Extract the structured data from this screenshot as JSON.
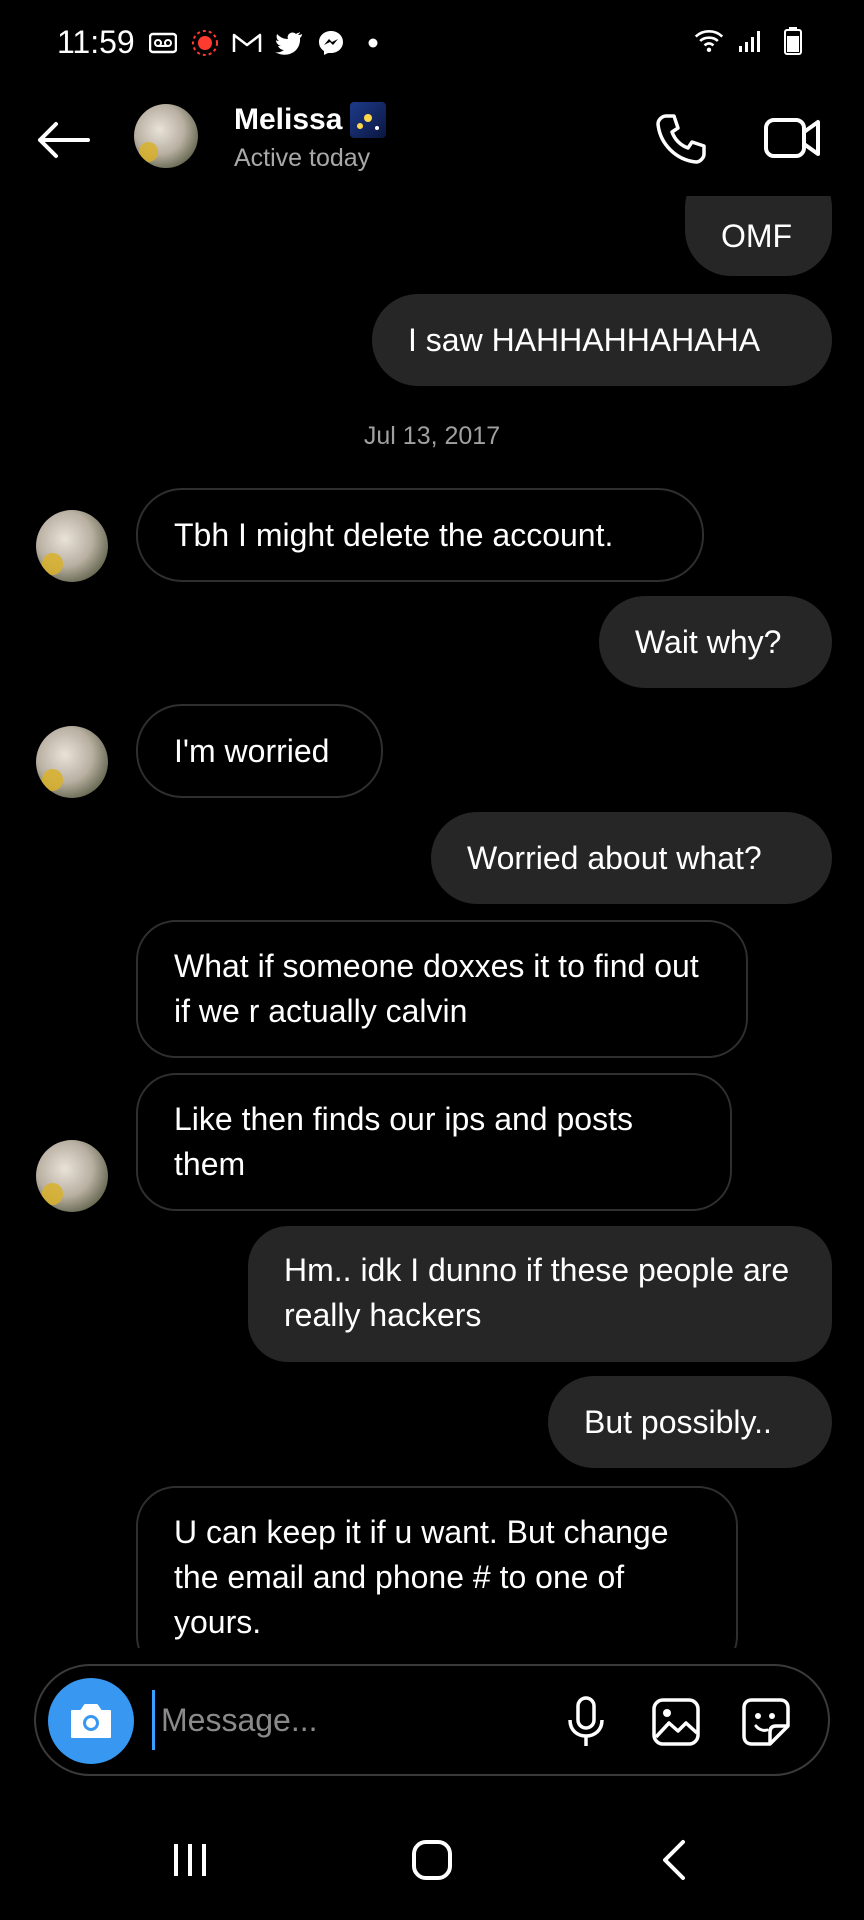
{
  "status_bar": {
    "time": "11:59",
    "left_icons": [
      "voicemail-icon",
      "recording-icon",
      "gmail-icon",
      "twitter-icon",
      "messenger-icon",
      "dot-icon"
    ],
    "right_icons": [
      "wifi-icon",
      "signal-icon",
      "battery-icon"
    ]
  },
  "header": {
    "contact_name": "Melissa",
    "name_emoji": "night-sky-emoji",
    "status": "Active today"
  },
  "thread": {
    "messages": [
      {
        "type": "sent",
        "text": "OMF"
      },
      {
        "type": "sent",
        "text": "I saw HAHHAHHAHAHA"
      },
      {
        "type": "date",
        "text": "Jul 13, 2017"
      },
      {
        "type": "received",
        "text": "Tbh I might delete the account."
      },
      {
        "type": "sent",
        "text": "Wait why?"
      },
      {
        "type": "received",
        "text": "I'm worried"
      },
      {
        "type": "sent",
        "text": "Worried about what?"
      },
      {
        "type": "received",
        "text": "What if someone doxxes it to find out if we r actually calvin"
      },
      {
        "type": "received",
        "text": "Like then finds our ips and posts them"
      },
      {
        "type": "sent",
        "text": "Hm.. idk I dunno if these people are really hackers"
      },
      {
        "type": "sent",
        "text": "But possibly.."
      },
      {
        "type": "received",
        "text": "U can keep it if u want. But change the email and phone # to one of yours."
      }
    ]
  },
  "composer": {
    "placeholder": "Message..."
  },
  "colors": {
    "background": "#000000",
    "sent_bubble": "#262626",
    "received_border": "#2f2f2f",
    "camera_button": "#3897f0"
  }
}
